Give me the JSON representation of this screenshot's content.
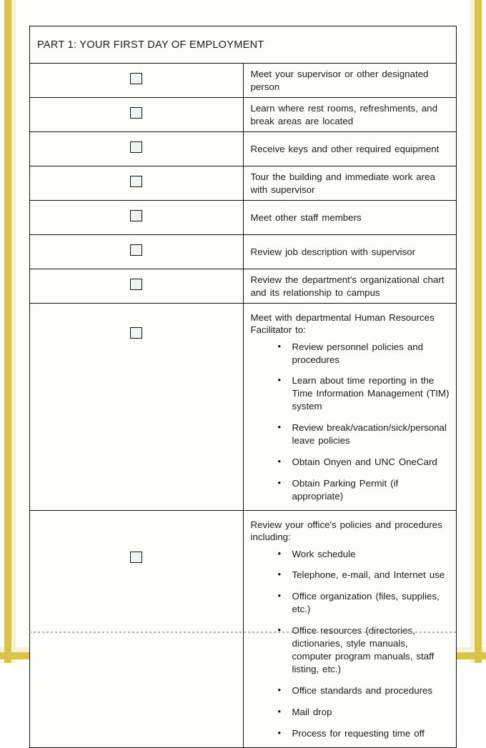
{
  "document": {
    "header": "PART 1: YOUR FIRST DAY OF EMPLOYMENT",
    "accent_color": "#d9c34a",
    "text_color": "#1a1a1a",
    "checkbox_fill": "#eef6f1"
  },
  "checklist": {
    "simple_items": [
      {
        "checkbox": "unchecked",
        "text": "Meet your supervisor  or other designated  person"
      },
      {
        "checkbox": "unchecked",
        "text": "Learn where rest rooms, refreshments,  and break areas are located"
      },
      {
        "checkbox": "unchecked",
        "text": "Receive keys and other required  equipment"
      },
      {
        "checkbox": "unchecked",
        "text": "Tour the building  and immediate work area with supervisor"
      },
      {
        "checkbox": "unchecked",
        "text": "Meet other staff members"
      },
      {
        "checkbox": "unchecked",
        "text": "Review job description  with supervisor"
      },
      {
        "checkbox": "unchecked",
        "text": "Review the department's  organizational  chart and its relationship  to campus"
      }
    ],
    "group_items": [
      {
        "checkbox": "unchecked",
        "lead": "Meet with departmental Human Resources  Facilitator  to:",
        "bullets": [
          "Review personnel  policies  and procedures",
          "Learn about time reporting  in the Time Information  Management  (TIM) system",
          "Review break/vacation/sick/personal  leave policies",
          "Obtain Onyen and UNC OneCard",
          "Obtain Parking  Permit (if appropriate)"
        ]
      },
      {
        "checkbox": "unchecked",
        "lead": "Review your office's policies  and procedures  including:",
        "bullets": [
          "Work schedule",
          "Telephone,  e-mail, and Internet  use",
          "Office organization  (files, supplies,  etc.)",
          "Office resources  (directories,  dictionaries,  style manuals,  computer  program manuals,  staff listing,  etc.)",
          "Office standards  and procedures",
          "Mail drop",
          "Process  for requesting  time off"
        ]
      }
    ]
  }
}
